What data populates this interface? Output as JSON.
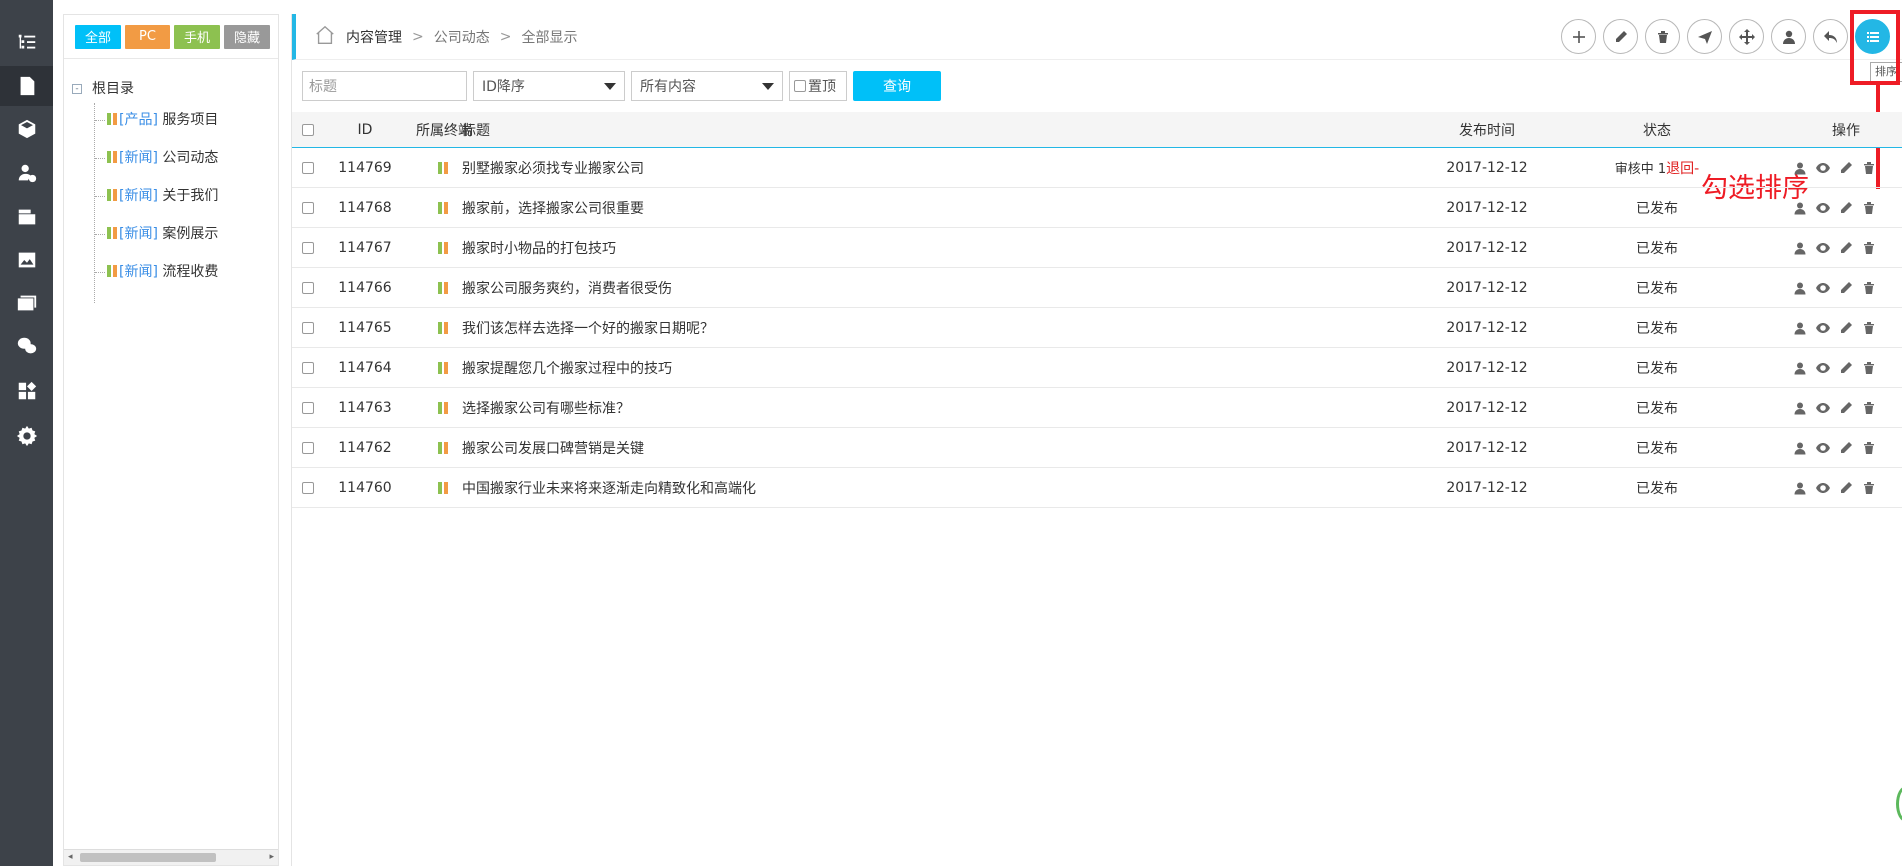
{
  "sidebar": {
    "icons": [
      "list-tree-icon",
      "document-icon",
      "cube-icon",
      "user-check-icon",
      "edit-doc-icon",
      "image-icon",
      "gallery-icon",
      "wechat-icon",
      "apps-icon",
      "settings-icon"
    ]
  },
  "filter": {
    "all": "全部",
    "pc": "PC",
    "mobile": "手机",
    "hidden": "隐藏",
    "colors": {
      "all": "#00c0f8",
      "pc": "#f29b44",
      "mobile": "#8dc150",
      "hidden": "#999999"
    }
  },
  "tree": {
    "root": "根目录",
    "minus": "-",
    "items": [
      {
        "tag": "[产品]",
        "label": "服务项目"
      },
      {
        "tag": "[新闻]",
        "label": "公司动态"
      },
      {
        "tag": "[新闻]",
        "label": "关于我们"
      },
      {
        "tag": "[新闻]",
        "label": "案例展示"
      },
      {
        "tag": "[新闻]",
        "label": "流程收费"
      }
    ]
  },
  "scroll": {
    "left": "◂",
    "right": "▸"
  },
  "breadcrumb": {
    "c1": "内容管理",
    "sep": ">",
    "c2": "公司动态",
    "c3": "全部显示"
  },
  "toolbar": {
    "tooltip": "排序"
  },
  "annotation": {
    "text": "勾选排序"
  },
  "search": {
    "title_placeholder": "标题",
    "order": "ID降序",
    "content": "所有内容",
    "sticky": "置顶",
    "query": "查询"
  },
  "table": {
    "headers": {
      "id": "ID",
      "term": "所属终端",
      "title": "标题",
      "date": "发布时间",
      "status": "状态",
      "ops": "操作"
    },
    "rows": [
      {
        "id": "114769",
        "title": "别墅搬家必须找专业搬家公司",
        "date": "2017-12-12",
        "status": "审核中 1",
        "status_extra": "退回-",
        "pending": true
      },
      {
        "id": "114768",
        "title": "搬家前，选择搬家公司很重要",
        "date": "2017-12-12",
        "status": "已发布"
      },
      {
        "id": "114767",
        "title": "搬家时小物品的打包技巧",
        "date": "2017-12-12",
        "status": "已发布"
      },
      {
        "id": "114766",
        "title": "搬家公司服务爽约，消费者很受伤",
        "date": "2017-12-12",
        "status": "已发布"
      },
      {
        "id": "114765",
        "title": "我们该怎样去选择一个好的搬家日期呢？",
        "date": "2017-12-12",
        "status": "已发布"
      },
      {
        "id": "114764",
        "title": "搬家提醒您几个搬家过程中的技巧",
        "date": "2017-12-12",
        "status": "已发布"
      },
      {
        "id": "114763",
        "title": "选择搬家公司有哪些标准？",
        "date": "2017-12-12",
        "status": "已发布"
      },
      {
        "id": "114762",
        "title": "搬家公司发展口碑营销是关键",
        "date": "2017-12-12",
        "status": "已发布"
      },
      {
        "id": "114760",
        "title": "中国搬家行业未来将来逐渐走向精致化和高端化",
        "date": "2017-12-12",
        "status": "已发布"
      }
    ]
  }
}
